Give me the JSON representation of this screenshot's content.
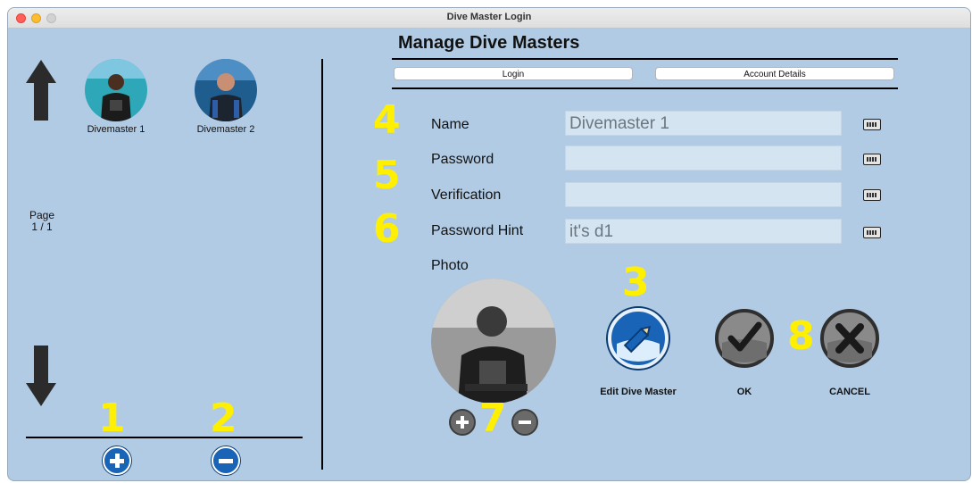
{
  "window": {
    "title": "Dive Master Login"
  },
  "left_panel": {
    "divemasters": [
      {
        "name": "Divemaster 1"
      },
      {
        "name": "Divemaster 2"
      }
    ],
    "page_label": "Page",
    "page_value": "1 / 1"
  },
  "annotations": {
    "n1": "1",
    "n2": "2",
    "n3": "3",
    "n4": "4",
    "n5": "5",
    "n6": "6",
    "n7": "7",
    "n8": "8",
    "color": "#ffef00"
  },
  "main": {
    "heading": "Manage Dive Masters",
    "tabs": [
      {
        "label": "Login"
      },
      {
        "label": "Account Details"
      }
    ],
    "fields": {
      "name": {
        "label": "Name",
        "value": "Divemaster 1"
      },
      "password": {
        "label": "Password",
        "value": ""
      },
      "verification": {
        "label": "Verification",
        "value": ""
      },
      "hint": {
        "label": "Password Hint",
        "value": "it's d1"
      }
    },
    "photo_label": "Photo",
    "buttons": {
      "edit": "Edit Dive Master",
      "ok": "OK",
      "cancel": "CANCEL"
    }
  },
  "colors": {
    "background": "#b1cbe4",
    "accent_blue": "#1a64b8",
    "field_bg": "#d4e4f1"
  }
}
